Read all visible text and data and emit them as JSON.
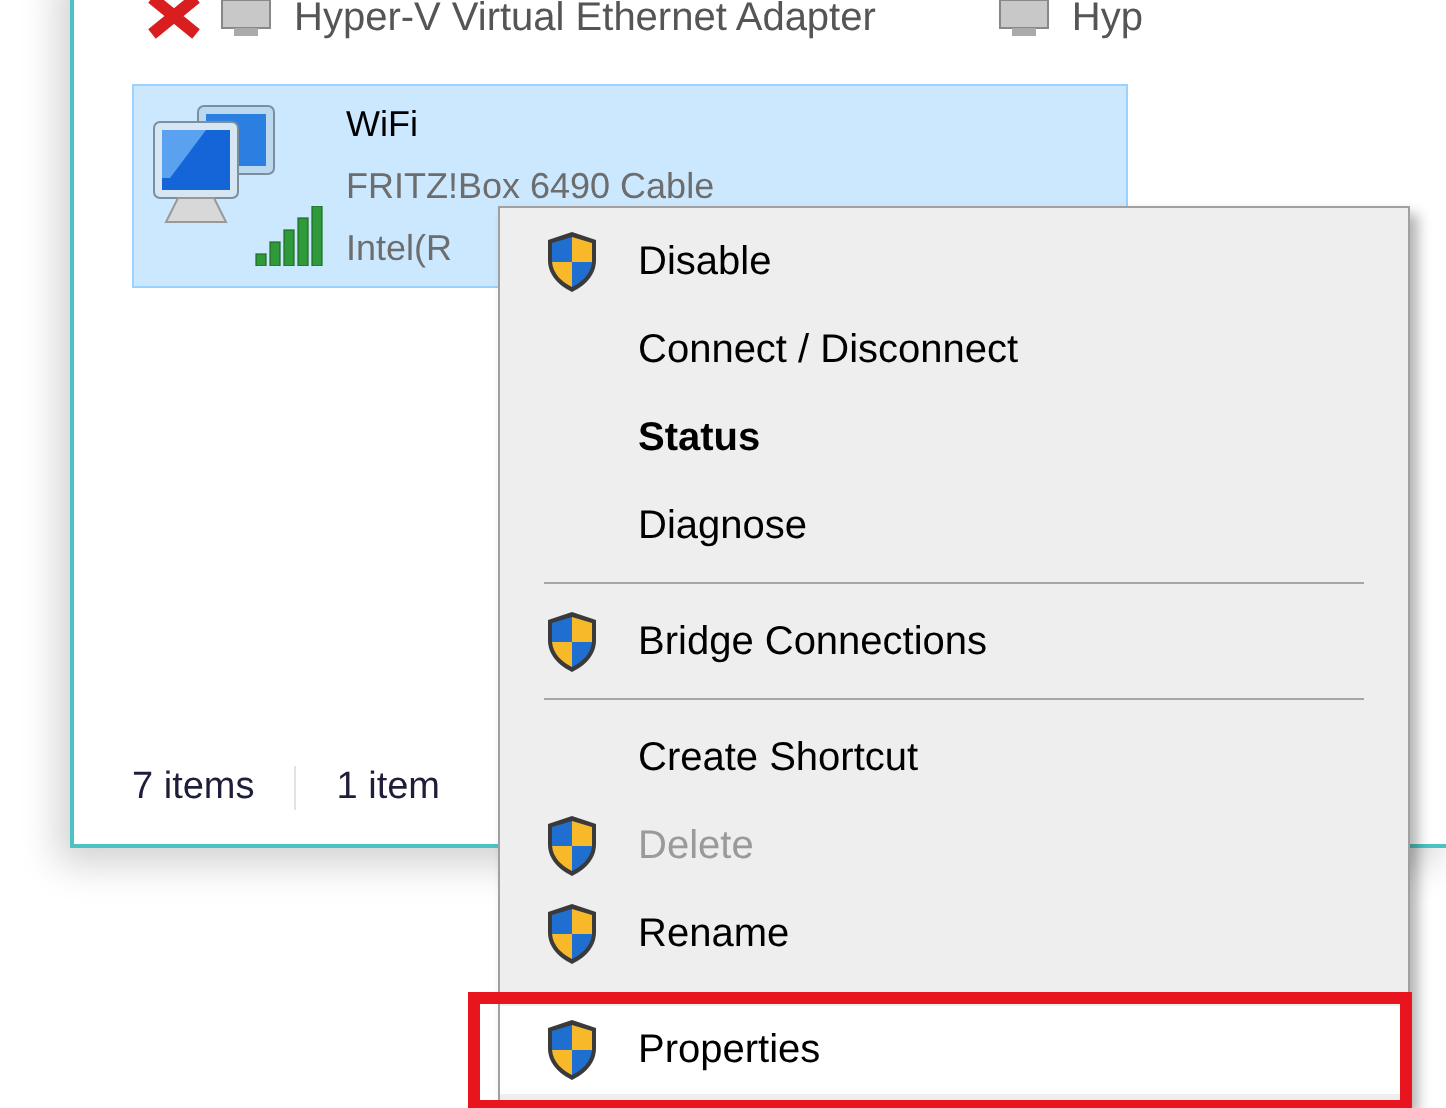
{
  "adapters": [
    {
      "name": "Hyper-V Virtual Ethernet Adapter",
      "error": true,
      "selected": false
    },
    {
      "name": "Hyp",
      "error": false,
      "selected": false
    }
  ],
  "selected_adapter": {
    "name": "WiFi",
    "network": "FRITZ!Box 6490 Cable",
    "device": "Intel(R",
    "selected": true
  },
  "status_bar": {
    "item_count": "7 items",
    "selection": "1 item"
  },
  "context_menu": [
    {
      "kind": "item",
      "label": "Disable",
      "shield": true,
      "bold": false,
      "disabled": false,
      "highlighted": false
    },
    {
      "kind": "item",
      "label": "Connect / Disconnect",
      "shield": false,
      "bold": false,
      "disabled": false,
      "highlighted": false
    },
    {
      "kind": "item",
      "label": "Status",
      "shield": false,
      "bold": true,
      "disabled": false,
      "highlighted": false
    },
    {
      "kind": "item",
      "label": "Diagnose",
      "shield": false,
      "bold": false,
      "disabled": false,
      "highlighted": false
    },
    {
      "kind": "separator"
    },
    {
      "kind": "item",
      "label": "Bridge Connections",
      "shield": true,
      "bold": false,
      "disabled": false,
      "highlighted": false
    },
    {
      "kind": "separator"
    },
    {
      "kind": "item",
      "label": "Create Shortcut",
      "shield": false,
      "bold": false,
      "disabled": false,
      "highlighted": false
    },
    {
      "kind": "item",
      "label": "Delete",
      "shield": true,
      "bold": false,
      "disabled": true,
      "highlighted": false
    },
    {
      "kind": "item",
      "label": "Rename",
      "shield": true,
      "bold": false,
      "disabled": false,
      "highlighted": false
    },
    {
      "kind": "item",
      "label": "Properties",
      "shield": true,
      "bold": false,
      "disabled": false,
      "highlighted": true
    }
  ]
}
